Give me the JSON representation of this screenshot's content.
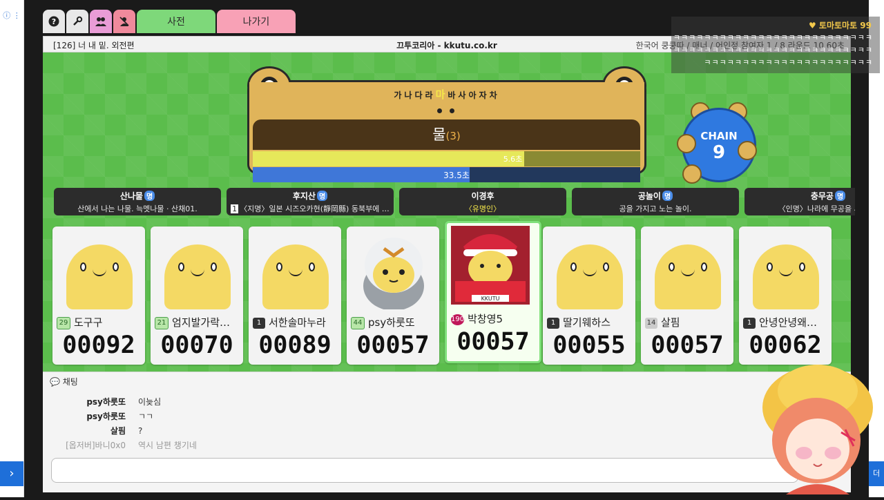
{
  "tabs": {
    "help_icon": "?",
    "settings_icon": "wrench-icon",
    "friends_icon": "users-icon",
    "user_icon": "user-icon",
    "dictionary": "사전",
    "exit": "나가기"
  },
  "infobar": {
    "room": "[126] 너 내 밑. 외전편",
    "site": "끄투코리아 - kkutu.co.kr",
    "meta": "한국어 쿵쿵따 / 매너 / 어인정   참여자 1 / 8    라운드 10     60초"
  },
  "board": {
    "hint_chars": [
      "가",
      "나",
      "다",
      "라",
      "마",
      "바",
      "사",
      "아",
      "자",
      "차"
    ],
    "hint_current": "마",
    "current_word": "물",
    "current_count": "(3)",
    "turn_time": "5.6초",
    "turn_fraction": 0.7,
    "round_time": "33.5초",
    "round_fraction": 0.56
  },
  "chain": {
    "label": "CHAIN",
    "value": "9"
  },
  "history": [
    {
      "word": "산나물",
      "tag": "명",
      "desc": "산에서 나는 나물. 늑멧나물 · 산채01."
    },
    {
      "word": "후지산",
      "tag": "명",
      "desc": "〈지명〉일본 시즈오카현(靜岡縣) 동북부에 …",
      "num": "1"
    },
    {
      "word": "이경후",
      "tag": "",
      "desc": "〈유명인〉"
    },
    {
      "word": "공놀이",
      "tag": "명",
      "desc": "공을 가지고 노는 놀이."
    },
    {
      "word": "충무공",
      "tag": "명",
      "desc": "〈인명〉나라에 무공을 세워 …"
    }
  ],
  "players": [
    {
      "level": "29",
      "level_style": "g",
      "name": "도구구",
      "score": "00092"
    },
    {
      "level": "21",
      "level_style": "g",
      "name": "엄지발가락…",
      "score": "00070"
    },
    {
      "level": "1",
      "level_style": "d",
      "name": "서한솔마누라",
      "score": "00089"
    },
    {
      "level": "44",
      "level_style": "g",
      "name": "psy하룻또",
      "score": "00057"
    },
    {
      "level": "190",
      "level_style": "r",
      "name": "박창영5",
      "score": "00057"
    },
    {
      "level": "1",
      "level_style": "d",
      "name": "딸기웨하스",
      "score": "00055"
    },
    {
      "level": "14",
      "level_style": "gy",
      "name": "살핌",
      "score": "00057"
    },
    {
      "level": "1",
      "level_style": "d",
      "name": "안녕안녕왜…",
      "score": "00062"
    }
  ],
  "car_plate": "KKUTU",
  "chat": {
    "title": "채팅",
    "messages": [
      {
        "who": "psy하룻또",
        "msg": "이늦심",
        "observer": false
      },
      {
        "who": "psy하룻또",
        "msg": "ㄱㄱ",
        "observer": false
      },
      {
        "who": "살핌",
        "msg": "?",
        "observer": false
      },
      {
        "who": "[옵저버]바니0x0",
        "msg": "역시 남편 챙기네",
        "observer": true
      }
    ]
  },
  "donation": {
    "name": "♥ 토마토마토 99",
    "text": "ㅋㅋㅋㅋㅋㅋㅋㅋㅋㅋㅋㅋㅋㅋㅋㅋㅋㅋㅋㅋㅋㅋㅋㅋㅋㅋㅋㅋㅋㅋㅋㅋㅋㅋㅋㅋㅋㅋㅋㅋㅋㅋㅋㅋㅋㅋㅋㅋㅋㅋㅋㅋㅋㅋㅋㅋㅋㅋㅋㅋㅋㅋㅋㅋㅋㅋㅋㅋㅋㅋㅋㅋㅋㅋ"
  },
  "side": {
    "right_button": "더",
    "left_arrow": "›",
    "left_mini": "ⓘ ⋮"
  },
  "colors": {
    "stage": "#5bbd4c",
    "frog": "#e0b45a",
    "chain": "#2f79e0",
    "accent_pink": "#f8a1b6",
    "accent_green": "#7ed87a"
  }
}
